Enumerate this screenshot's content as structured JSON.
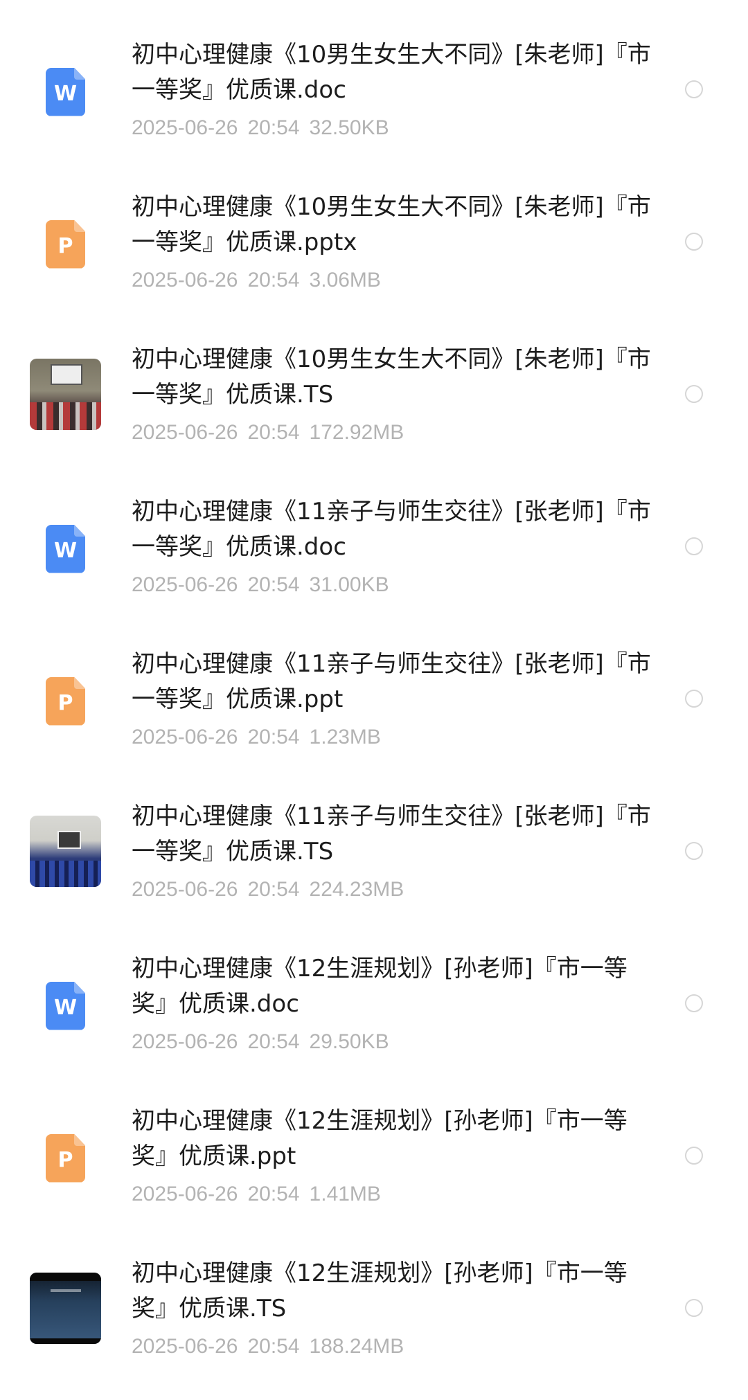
{
  "files": [
    {
      "name": "初中心理健康《10男生女生大不同》[朱老师]『市一等奖』优质课.doc",
      "date": "2025-06-26",
      "time": "20:54",
      "size": "32.50KB",
      "icon": "word-file-icon"
    },
    {
      "name": "初中心理健康《10男生女生大不同》[朱老师]『市一等奖』优质课.pptx",
      "date": "2025-06-26",
      "time": "20:54",
      "size": "3.06MB",
      "icon": "ppt-file-icon"
    },
    {
      "name": "初中心理健康《10男生女生大不同》[朱老师]『市一等奖』优质课.TS",
      "date": "2025-06-26",
      "time": "20:54",
      "size": "172.92MB",
      "icon": "video-thumbnail"
    },
    {
      "name": "初中心理健康《11亲子与师生交往》[张老师]『市一等奖』优质课.doc",
      "date": "2025-06-26",
      "time": "20:54",
      "size": "31.00KB",
      "icon": "word-file-icon"
    },
    {
      "name": "初中心理健康《11亲子与师生交往》[张老师]『市一等奖』优质课.ppt",
      "date": "2025-06-26",
      "time": "20:54",
      "size": "1.23MB",
      "icon": "ppt-file-icon"
    },
    {
      "name": "初中心理健康《11亲子与师生交往》[张老师]『市一等奖』优质课.TS",
      "date": "2025-06-26",
      "time": "20:54",
      "size": "224.23MB",
      "icon": "video-thumbnail"
    },
    {
      "name": "初中心理健康《12生涯规划》[孙老师]『市一等奖』优质课.doc",
      "date": "2025-06-26",
      "time": "20:54",
      "size": "29.50KB",
      "icon": "word-file-icon"
    },
    {
      "name": "初中心理健康《12生涯规划》[孙老师]『市一等奖』优质课.ppt",
      "date": "2025-06-26",
      "time": "20:54",
      "size": "1.41MB",
      "icon": "ppt-file-icon"
    },
    {
      "name": "初中心理健康《12生涯规划》[孙老师]『市一等奖』优质课.TS",
      "date": "2025-06-26",
      "time": "20:54",
      "size": "188.24MB",
      "icon": "video-thumbnail"
    }
  ],
  "icon_labels": {
    "word": "W",
    "ppt": "P"
  },
  "colors": {
    "word": "#4b8bf4",
    "ppt": "#f6a45a",
    "meta_text": "#b3b3b3",
    "name_text": "#1c1c1c"
  }
}
